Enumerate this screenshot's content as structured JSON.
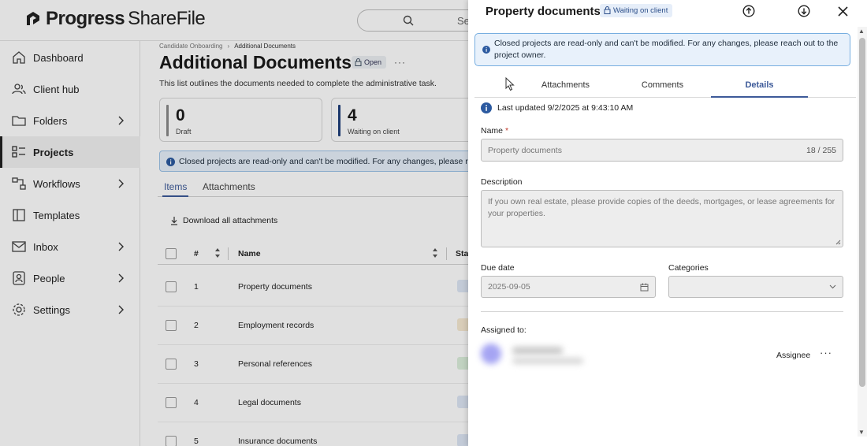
{
  "app": {
    "brand_strong": "Progress",
    "brand_light": "ShareFile"
  },
  "search": {
    "placeholder": "Se"
  },
  "sidebar": {
    "items": [
      {
        "label": "Dashboard",
        "icon": "home-icon"
      },
      {
        "label": "Client hub",
        "icon": "users-icon"
      },
      {
        "label": "Folders",
        "icon": "folder-icon"
      },
      {
        "label": "Projects",
        "icon": "projects-icon"
      },
      {
        "label": "Workflows",
        "icon": "workflow-icon"
      },
      {
        "label": "Templates",
        "icon": "template-icon"
      },
      {
        "label": "Inbox",
        "icon": "mail-icon"
      },
      {
        "label": "People",
        "icon": "person-icon"
      },
      {
        "label": "Settings",
        "icon": "gear-icon"
      }
    ]
  },
  "main": {
    "breadcrumb": [
      "Candidate Onboarding",
      "Additional Documents"
    ],
    "title": "Additional Documents",
    "status_badge": "Open",
    "description": "This list outlines the documents needed to complete the administrative task.",
    "stats": [
      {
        "value": "0",
        "caption": "Draft",
        "color": "#8a8a8a"
      },
      {
        "value": "4",
        "caption": "Waiting on client",
        "color": "#1f3f7a"
      }
    ],
    "banner": "Closed projects are read-only and can't be modified. For any changes, please reach out to the project owner.",
    "tabs": [
      "Items",
      "Attachments"
    ],
    "download_all": "Download all attachments",
    "columns": {
      "num": "#",
      "name": "Name",
      "status": "Sta"
    },
    "rows": [
      {
        "num": "1",
        "name": "Property documents",
        "status_color": "#dde6f5"
      },
      {
        "num": "2",
        "name": "Employment records",
        "status_color": "#f6ead2"
      },
      {
        "num": "3",
        "name": "Personal references",
        "status_color": "#dcefdc"
      },
      {
        "num": "4",
        "name": "Legal documents",
        "status_color": "#dde6f5"
      },
      {
        "num": "5",
        "name": "Insurance documents",
        "status_color": "#dde6f5"
      }
    ]
  },
  "drawer": {
    "title": "Property documents",
    "status": "Waiting on client",
    "banner": "Closed projects are read-only and can't be modified. For any changes, please reach out to the project owner.",
    "tabs": [
      "Attachments",
      "Comments",
      "Details"
    ],
    "active_tab": "Details",
    "last_updated": "Last updated 9/2/2025 at 9:43:10 AM",
    "name_label": "Name",
    "name_required": "*",
    "name_value": "Property documents",
    "name_count": "18 / 255",
    "description_label": "Description",
    "description_value": "If you own real estate, please provide copies of the deeds, mortgages, or lease agreements for your properties.",
    "due_date_label": "Due date",
    "due_date_value": "2025-09-05",
    "categories_label": "Categories",
    "categories_value": "",
    "assigned_label": "Assigned to:",
    "assignee_role": "Assignee"
  },
  "colors": {
    "accent": "#3d5a99",
    "banner_bg": "#e8f1fb",
    "banner_border": "#77aee0",
    "required": "#c0392b"
  }
}
